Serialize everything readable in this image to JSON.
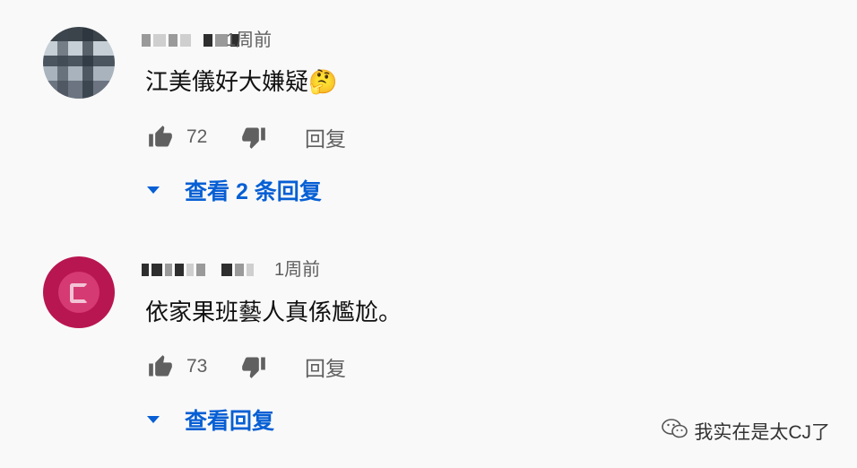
{
  "comments": [
    {
      "timestamp": "1周前",
      "text": "江美儀好大嫌疑🤔",
      "likes": "72",
      "reply_label": "回复",
      "replies_toggle": "查看 2 条回复"
    },
    {
      "timestamp": "1周前",
      "text": "依家果班藝人真係尷尬。",
      "likes": "73",
      "reply_label": "回复",
      "replies_toggle": "查看回复"
    }
  ],
  "watermark": {
    "text": "我实在是太CJ了"
  },
  "icons": {
    "like": "thumbs-up-icon",
    "dislike": "thumbs-down-icon",
    "expand": "caret-down-icon",
    "watermark": "wechat-icon"
  },
  "colors": {
    "link": "#065fd4",
    "secondary_text": "#606060"
  }
}
